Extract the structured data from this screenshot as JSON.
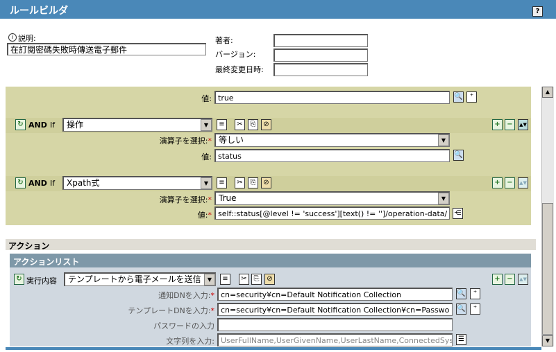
{
  "header": {
    "title": "ルールビルダ",
    "help_label": "?"
  },
  "meta": {
    "description_label": "説明:",
    "description_value": "在訂閱密碼失敗時傳送電子郵件",
    "author_label": "著者:",
    "version_label": "バージョン:",
    "modified_label": "最終変更日時:",
    "author_value": "",
    "version_value": "",
    "modified_value": ""
  },
  "conditions": {
    "prev_value_label": "値:",
    "prev_value": "true",
    "rows": [
      {
        "conj": "AND",
        "if": "If",
        "selector": "操作",
        "operator_label": "演算子を選択:",
        "operator": "等しい",
        "value_label": "値:",
        "value": "status"
      },
      {
        "conj": "AND",
        "if": "If",
        "selector": "Xpath式",
        "operator_label": "演算子を選択:",
        "operator": "True",
        "value_label": "値:",
        "value": "self::status[@level != 'success'][text() != '']/operation-data/"
      }
    ]
  },
  "actions": {
    "section_title": "アクション",
    "list_title": "アクションリスト",
    "do_label": "実行内容",
    "do_value": "テンプレートから電子メールを送信",
    "fields": [
      {
        "label": "通知DNを入力:",
        "value": "cn=security¥cn=Default Notification Collection"
      },
      {
        "label": "テンプレートDNを入力:",
        "value": "cn=security¥cn=Default Notification Collection¥cn=Passwo"
      },
      {
        "label": "パスワードの入力",
        "value": ""
      },
      {
        "label": "文字列を入力:",
        "value": "UserFullName,UserGivenName,UserLastName,ConnectedSys"
      }
    ]
  },
  "colors": {
    "header": "#4a88b8",
    "condition_panel": "#d6d6a6",
    "action_header": "#7e98a8",
    "action_panel": "#d0d8e0"
  }
}
